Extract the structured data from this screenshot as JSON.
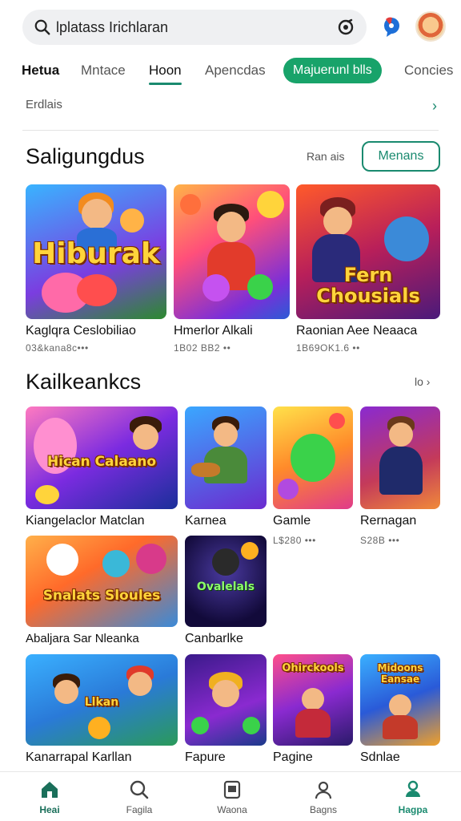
{
  "search": {
    "text": "lplatass Irichlaran"
  },
  "tabs": [
    {
      "label": "Hetua"
    },
    {
      "label": "Mntace"
    },
    {
      "label": "Hoon"
    },
    {
      "label": "Apencdas"
    },
    {
      "label": "Majuerunl blls"
    },
    {
      "label": "Concies"
    }
  ],
  "subheader": {
    "label": "Erdlais"
  },
  "section1": {
    "title": "Saligungdus",
    "see_all": "Ran ais",
    "button": "Menans",
    "items": [
      {
        "title": "Kaglqra Ceslobiliao",
        "meta": "03&kana8c•••",
        "art_text": "Hiburak"
      },
      {
        "title": "Hmerlor Alkali",
        "meta": "1B02 BB2 ••",
        "art_text": ""
      },
      {
        "title": "Raonian Aee Neaaca",
        "meta": "1B69OK1.6 ••",
        "art_text": "Fern Chousials"
      }
    ]
  },
  "section2": {
    "title": "Kailkeankcs",
    "see_all": "lo",
    "items": [
      {
        "title": "Kiangelaclor Matclan",
        "meta": "",
        "art_text": "Hican Calaano"
      },
      {
        "title": "Karnea",
        "meta": ""
      },
      {
        "title": "Gamle",
        "meta": "L$280 •••"
      },
      {
        "title": "Rernagan",
        "meta": "S28B •••"
      },
      {
        "title": "Abaljara Sar Nleanka",
        "meta": "",
        "art_text": "Snalats Sloules"
      },
      {
        "title": "Canbarlke",
        "meta": "",
        "art_text": "Ovalelals"
      },
      {
        "title": "Kanarrapal Karllan",
        "meta": "",
        "art_text": "Llkan"
      },
      {
        "title": "Fapure",
        "meta": ""
      },
      {
        "title": "Pagine",
        "meta": "",
        "art_text": "Ohirckools"
      },
      {
        "title": "Sdnlae",
        "meta": "",
        "art_text": "Midoons Eansae"
      }
    ]
  },
  "bottom_nav": [
    {
      "label": "Heai",
      "icon": "home-icon"
    },
    {
      "label": "Fagila",
      "icon": "search-icon"
    },
    {
      "label": "Waona",
      "icon": "library-icon"
    },
    {
      "label": "Bagns",
      "icon": "profile-icon"
    },
    {
      "label": "Hagpa",
      "icon": "account-icon"
    }
  ],
  "colors": {
    "accent": "#1a8a6f",
    "pill": "#18a36a"
  }
}
